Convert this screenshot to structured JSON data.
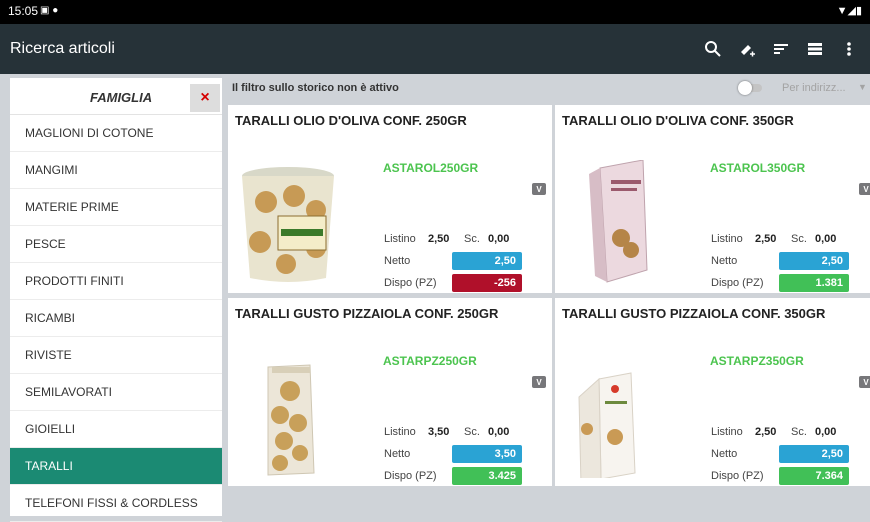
{
  "status": {
    "time": "15:05"
  },
  "appbar": {
    "title": "Ricerca articoli"
  },
  "sidebar": {
    "title": "FAMIGLIA",
    "close": "×",
    "items": [
      {
        "label": "MAGLIONI DI COTONE"
      },
      {
        "label": "MANGIMI"
      },
      {
        "label": "MATERIE PRIME"
      },
      {
        "label": "PESCE"
      },
      {
        "label": "PRODOTTI FINITI"
      },
      {
        "label": "RICAMBI"
      },
      {
        "label": "RIVISTE"
      },
      {
        "label": "SEMILAVORATI"
      },
      {
        "label": "GIOIELLI"
      },
      {
        "label": "TARALLI"
      },
      {
        "label": "TELEFONI FISSI & CORDLESS"
      }
    ]
  },
  "filter": {
    "text": "Il filtro sullo storico non è attivo",
    "select": "Per indirizz..."
  },
  "labels": {
    "listino": "Listino",
    "sc": "Sc.",
    "netto": "Netto",
    "dispo": "Dispo (PZ)",
    "v": "V"
  },
  "products": [
    {
      "title": "TARALLI OLIO D'OLIVA CONF. 250GR",
      "code": "ASTAROL250GR",
      "listino": "2,50",
      "sc": "0,00",
      "netto": "2,50",
      "dispo": "-256",
      "dispo_status": "negative"
    },
    {
      "title": "TARALLI OLIO D'OLIVA CONF. 350GR",
      "code": "ASTAROL350GR",
      "listino": "2,50",
      "sc": "0,00",
      "netto": "2,50",
      "dispo": "1.381",
      "dispo_status": "positive"
    },
    {
      "title": "TARALLI GUSTO PIZZAIOLA CONF. 250GR",
      "code": "ASTARPZ250GR",
      "listino": "3,50",
      "sc": "0,00",
      "netto": "3,50",
      "dispo": "3.425",
      "dispo_status": "positive"
    },
    {
      "title": "TARALLI GUSTO PIZZAIOLA CONF. 350GR",
      "code": "ASTARPZ350GR",
      "listino": "2,50",
      "sc": "0,00",
      "netto": "2,50",
      "dispo": "7.364",
      "dispo_status": "positive"
    }
  ],
  "colors": {
    "appbar": "#263238",
    "active": "#1b8a73",
    "code": "#4cc44f",
    "blue": "#2aa3d4",
    "red": "#b0102a",
    "green": "#41c057"
  }
}
